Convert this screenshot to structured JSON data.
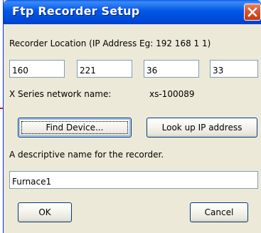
{
  "window": {
    "title": "Ftp Recorder Setup",
    "close_glyph": "✕"
  },
  "recorder": {
    "location_label": "Recorder Location (IP Address Eg: 192 168 1 1)",
    "ip_octets": [
      "160",
      "221",
      "36",
      "33"
    ],
    "network_name_label": "X Series network name:",
    "network_name_value": "xs-100089"
  },
  "actions": {
    "find_device_label": "Find Device...",
    "lookup_ip_label": "Look up IP address",
    "ok_label": "OK",
    "cancel_label": "Cancel"
  },
  "description": {
    "label": "A descriptive name for the recorder.",
    "value": "Furnace1"
  },
  "colors": {
    "titlebar": "#0054e3",
    "dialog_face": "#ece9d8",
    "close_button": "#d9562e",
    "pointer_arrow": "#e3121b"
  },
  "icons": {
    "close": "close-icon",
    "pointer": "arrow-right-icon"
  }
}
